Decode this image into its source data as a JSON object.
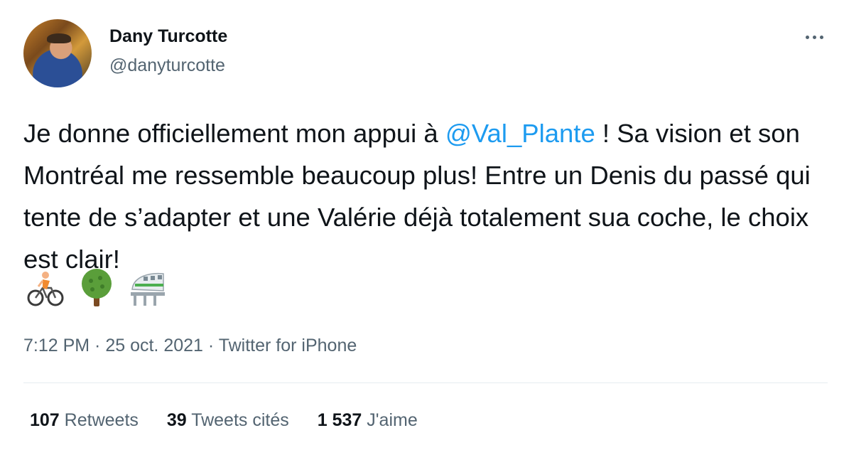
{
  "author": {
    "name": "Dany Turcotte",
    "handle": "@danyturcotte"
  },
  "tweet": {
    "text_before_mention": "Je donne officiellement mon appui à ",
    "mention": "@Val_Plante",
    "text_after_mention": " ! Sa vision et son Montréal me ressemble beaucoup plus! Entre un Denis du passé qui tente de s’adapter et une Valérie déjà totalement sua coche, le choix est clair!",
    "emojis": [
      "bicyclist-icon",
      "tree-icon",
      "monorail-icon"
    ]
  },
  "meta": {
    "time": "7:12 PM",
    "separator": " · ",
    "date": "25 oct. 2021",
    "source": "Twitter for iPhone"
  },
  "stats": {
    "retweets_count": "107",
    "retweets_label": "Retweets",
    "quotes_count": "39",
    "quotes_label": "Tweets cités",
    "likes_count": "1 537",
    "likes_label": "J'aime"
  },
  "colors": {
    "accent": "#1d9bf0",
    "text": "#0f1419",
    "muted": "#536471"
  }
}
